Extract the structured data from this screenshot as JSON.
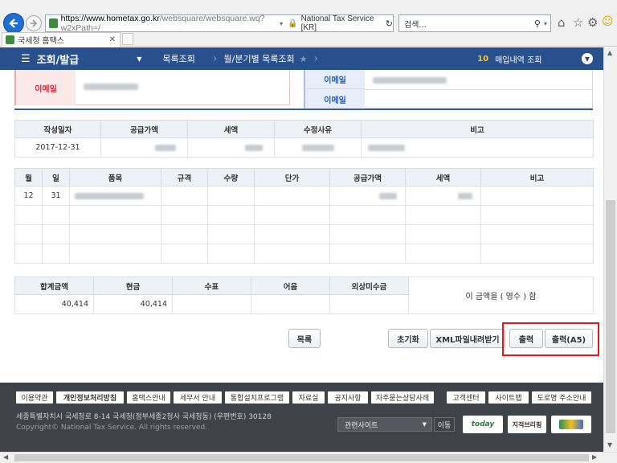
{
  "browser": {
    "url_host": "https://www.hometax.go.kr",
    "url_path": "/websquare/websquare.wq?w2xPath=/",
    "site_identity": "National Tax Service [KR]",
    "search_placeholder": "검색...",
    "tab_title": "국세청 홈택스"
  },
  "nav": {
    "menu_title": "조회/발급",
    "crumb1": "목록조회",
    "crumb2": "월/분기별 목록조회",
    "badge_number": "10",
    "badge_text": "매입내역 조회"
  },
  "email_section": {
    "label_left": "이메일",
    "label_right1": "이메일",
    "label_right2": "이메일"
  },
  "summary_table": {
    "headers": [
      "작성일자",
      "공급가액",
      "세액",
      "수정사유",
      "비고"
    ],
    "row": [
      "2017-12-31",
      "",
      "",
      "",
      ""
    ]
  },
  "items_table": {
    "headers": [
      "월",
      "일",
      "품목",
      "규격",
      "수량",
      "단가",
      "공급가액",
      "세액",
      "비고"
    ],
    "row1": [
      "12",
      "31"
    ]
  },
  "totals_table": {
    "headers": [
      "합계금액",
      "현금",
      "수표",
      "어음",
      "외상미수금"
    ],
    "values": [
      "40,414",
      "40,414",
      "",
      "",
      ""
    ],
    "note": "이 금액을 ( 영수 ) 함"
  },
  "buttons": {
    "list": "목록",
    "reset": "초기화",
    "xml": "XML파일내려받기",
    "print": "출력",
    "print_a5": "출력(A5)"
  },
  "footer": {
    "links": [
      "이용약관",
      "개인정보처리방침",
      "홈택스안내",
      "세무서 안내",
      "통합설치프로그램",
      "자료실",
      "공지사항",
      "자주묻는상담사례"
    ],
    "links_right": [
      "고객센터",
      "사이트맵",
      "도로명 주소안내"
    ],
    "address": "세종특별자치시 국세청로 8-14 국세청(정부세종2청사 국세청동) (우편번호) 30128",
    "copyright": "Copyright© National Tax Service. All rights reserved.",
    "related_select": "관련사이트",
    "go_button": "이동",
    "badge_today": "today",
    "badge_brief": "지적브리핑"
  },
  "colors": {
    "nav_blue": "#27508d",
    "highlight_red": "#e0191f",
    "footer_bg": "#3f4247"
  }
}
